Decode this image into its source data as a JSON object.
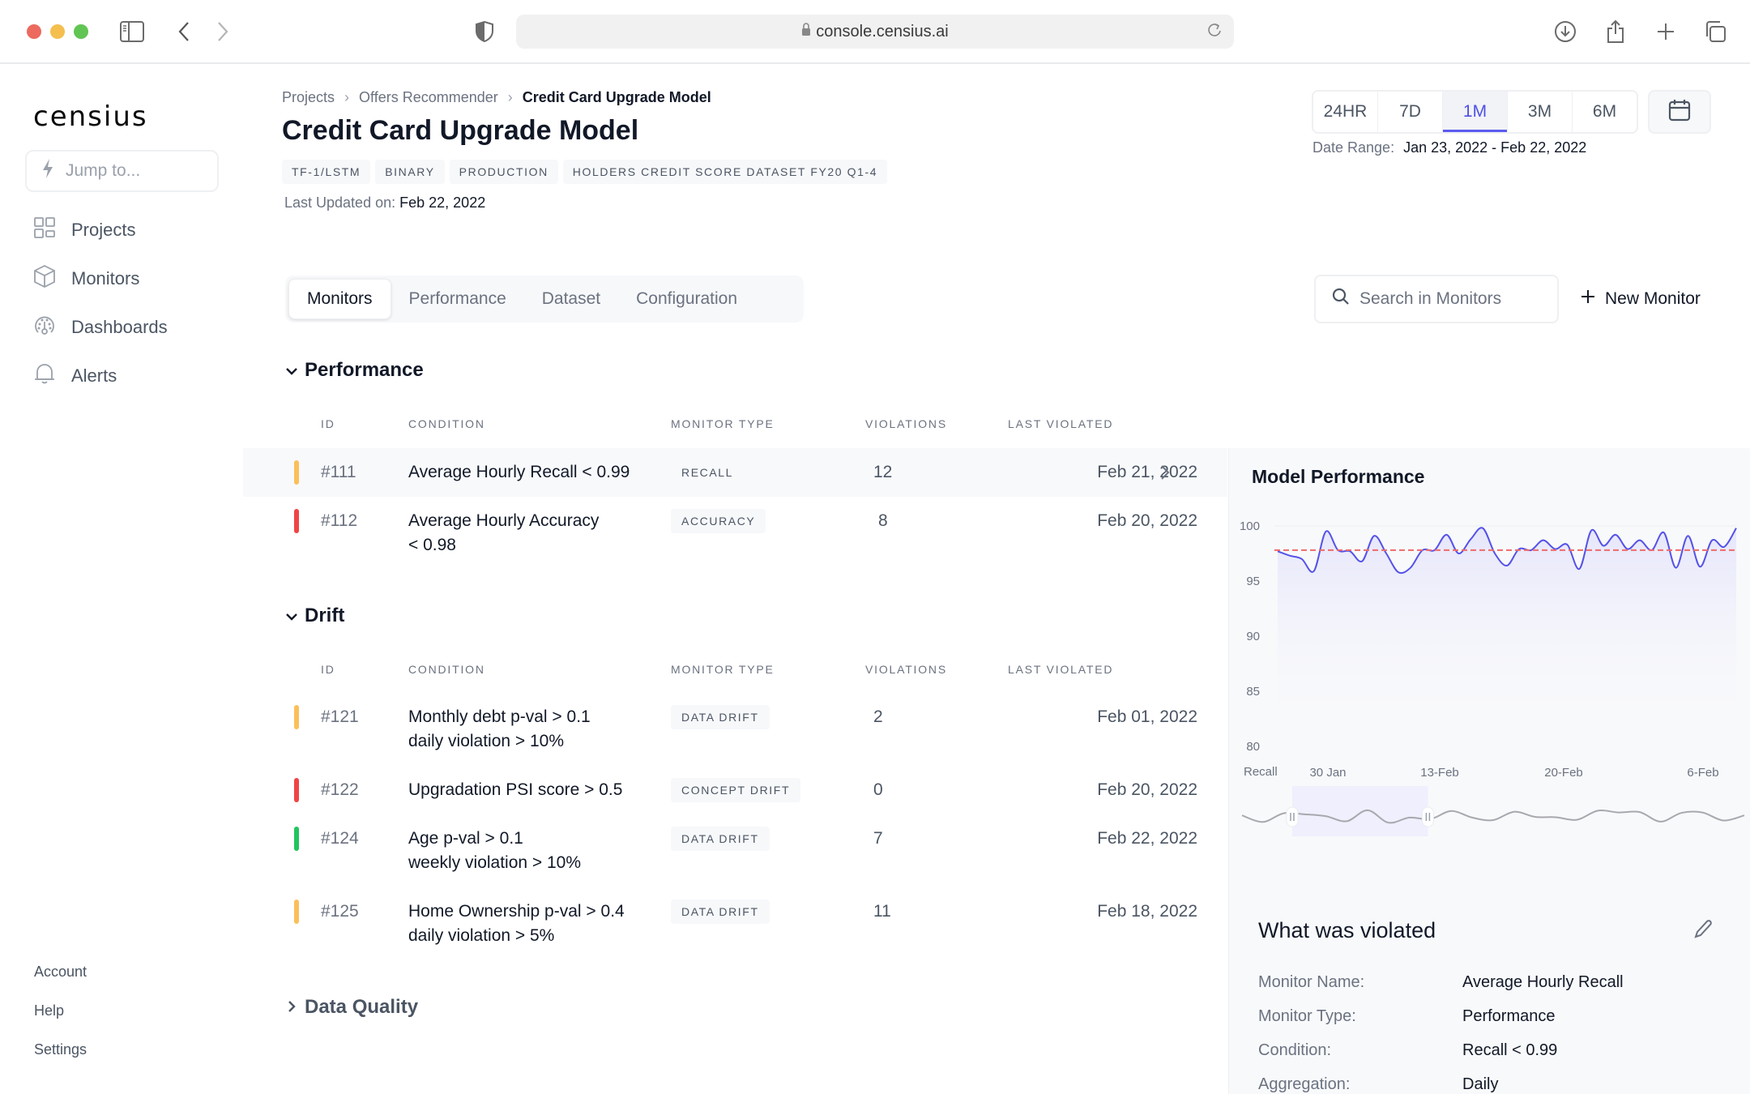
{
  "browser": {
    "url": "console.censius.ai"
  },
  "sidebar": {
    "logo": "censius",
    "jump_placeholder": "Jump to...",
    "items": [
      {
        "label": "Projects",
        "icon": "grid-icon"
      },
      {
        "label": "Monitors",
        "icon": "cube-icon"
      },
      {
        "label": "Dashboards",
        "icon": "gauge-icon"
      },
      {
        "label": "Alerts",
        "icon": "bell-icon"
      }
    ],
    "footer": [
      "Account",
      "Help",
      "Settings"
    ]
  },
  "header": {
    "breadcrumb": [
      "Projects",
      "Offers Recommender",
      "Credit Card Upgrade Model"
    ],
    "title": "Credit Card Upgrade Model",
    "tags": [
      "TF-1/LSTM",
      "BINARY",
      "PRODUCTION",
      "HOLDERS CREDIT SCORE DATASET FY20 Q1-4"
    ],
    "last_updated_label": "Last Updated on:",
    "last_updated_value": "Feb 22, 2022",
    "ranges": [
      "24HR",
      "7D",
      "1M",
      "3M",
      "6M"
    ],
    "active_range": "1M",
    "date_range_label": "Date Range:",
    "date_range_value": "Jan 23, 2022 - Feb 22, 2022"
  },
  "tabs": [
    "Monitors",
    "Performance",
    "Dataset",
    "Configuration"
  ],
  "active_tab": "Monitors",
  "search": {
    "placeholder": "Search in Monitors"
  },
  "new_monitor_label": "New Monitor",
  "columns": [
    "ID",
    "CONDITION",
    "MONITOR TYPE",
    "VIOLATIONS",
    "LAST VIOLATED"
  ],
  "colors": {
    "yellow": "#fbbf5a",
    "red": "#ef4444",
    "green": "#22c55e",
    "accent": "#5b5bf0"
  },
  "sections": [
    {
      "title": "Performance",
      "expanded": true,
      "rows": [
        {
          "id": "#111",
          "condition": [
            "Average Hourly Recall < 0.99"
          ],
          "type": "RECALL",
          "violations": "12",
          "last": "Feb 21, 2022",
          "status": "yellow",
          "selected": true
        },
        {
          "id": "#112",
          "condition": [
            "Average Hourly Accuracy",
            "< 0.98"
          ],
          "type": "ACCURACY",
          "violations": "8",
          "last": "Feb 20, 2022",
          "status": "red"
        }
      ]
    },
    {
      "title": "Drift",
      "expanded": true,
      "rows": [
        {
          "id": "#121",
          "condition": [
            "Monthly debt p-val > 0.1",
            "daily violation > 10%"
          ],
          "type": "DATA DRIFT",
          "violations": "2",
          "last": "Feb 01, 2022",
          "status": "yellow"
        },
        {
          "id": "#122",
          "condition": [
            "Upgradation PSI score > 0.5"
          ],
          "type": "CONCEPT DRIFT",
          "violations": "0",
          "last": "Feb 20, 2022",
          "status": "red"
        },
        {
          "id": "#124",
          "condition": [
            "Age p-val > 0.1",
            "weekly violation > 10%"
          ],
          "type": "DATA DRIFT",
          "violations": "7",
          "last": "Feb 22, 2022",
          "status": "green"
        },
        {
          "id": "#125",
          "condition": [
            "Home Ownership p-val > 0.4",
            "daily violation > 5%"
          ],
          "type": "DATA DRIFT",
          "violations": "11",
          "last": "Feb 18, 2022",
          "status": "yellow"
        }
      ]
    },
    {
      "title": "Data Quality",
      "expanded": false,
      "rows": []
    }
  ],
  "panel": {
    "title": "Model Performance",
    "violated_title": "What was violated",
    "details": [
      {
        "label": "Monitor Name:",
        "value": "Average Hourly Recall"
      },
      {
        "label": "Monitor Type:",
        "value": "Performance"
      },
      {
        "label": "Condition:",
        "value": "Recall < 0.99"
      },
      {
        "label": "Aggregation:",
        "value": "Daily"
      }
    ]
  },
  "chart_data": {
    "type": "line",
    "title": "Model Performance",
    "ylabel": "Recall",
    "ylim": [
      80,
      100
    ],
    "yticks": [
      100,
      95,
      90,
      85,
      80
    ],
    "xtick_labels": [
      "30 Jan",
      "13-Feb",
      "20-Feb",
      "6-Feb"
    ],
    "threshold": 97.8,
    "series": [
      {
        "name": "Recall",
        "values": [
          97.7,
          97.3,
          97.0,
          95.9,
          99.5,
          97.8,
          97.7,
          96.8,
          99.1,
          97.5,
          95.8,
          96.2,
          97.8,
          97.8,
          99.2,
          97.5,
          98.8,
          99.8,
          97.5,
          96.4,
          97.9,
          97.8,
          98.7,
          97.9,
          98.3,
          96.1,
          99.6,
          98.2,
          99.2,
          97.9,
          98.7,
          97.8,
          99.4,
          96.2,
          99.1,
          96.3,
          98.7,
          98.1,
          99.8
        ]
      }
    ],
    "navigator": {
      "values": [
        97.6,
        95.8,
        98.2,
        97.9,
        97.4,
        96.0,
        99.0,
        95.6,
        97.0,
        96.6,
        98.8,
        97.0,
        96.3,
        98.6,
        97.2,
        97.1,
        96.4,
        98.9,
        98.4,
        98.5,
        95.9,
        98.3,
        98.4,
        96.2,
        97.6
      ],
      "selection": [
        0.1,
        0.37
      ]
    }
  }
}
